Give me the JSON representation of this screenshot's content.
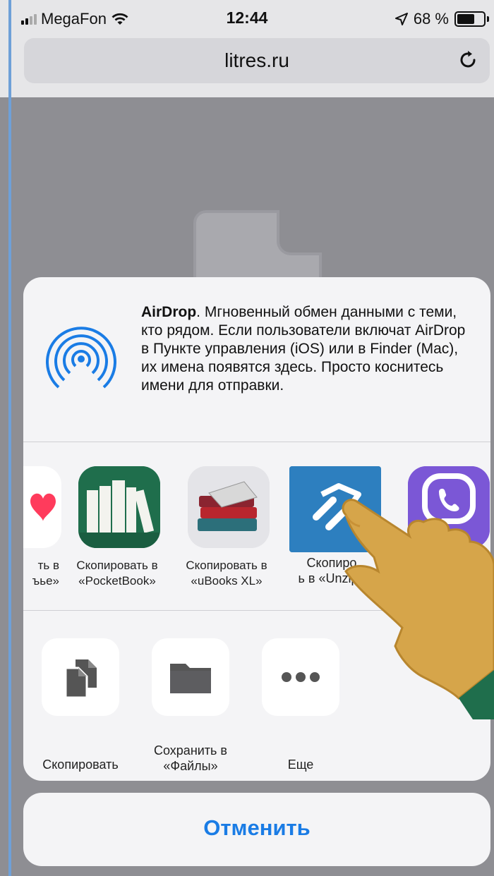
{
  "status_bar": {
    "carrier": "MegaFon",
    "time": "12:44",
    "battery_percent": "68 %",
    "battery_level": 0.68
  },
  "address_bar": {
    "url": "litres.ru"
  },
  "share_sheet": {
    "airdrop": {
      "title": "AirDrop",
      "description": ". Мгновенный обмен данными с теми, кто рядом. Если пользователи включат AirDrop в Пункте управления (iOS) или в Finder (Mac), их имена появятся здесь. Просто коснитесь имени для отправки."
    },
    "apps": [
      {
        "label_line1": "ть в",
        "label_line2": "ъье»",
        "icon": "heart-app-icon"
      },
      {
        "label_line1": "Скопировать в",
        "label_line2": "«PocketBook»",
        "icon": "pocketbook-icon"
      },
      {
        "label_line1": "Скопировать в",
        "label_line2": "«uBooks XL»",
        "icon": "ubooks-icon"
      },
      {
        "label_line1": "Скопиро",
        "label_line2": "ь в «Unzip»",
        "icon": "unzip-icon"
      },
      {
        "label_line1": "",
        "label_line2": "",
        "icon": "viber-icon"
      }
    ],
    "actions": [
      {
        "label": "Скопировать",
        "icon": "copy-icon"
      },
      {
        "label": "Сохранить в «Файлы»",
        "icon": "folder-icon"
      },
      {
        "label": "Еще",
        "icon": "more-icon"
      }
    ],
    "cancel_label": "Отменить"
  },
  "colors": {
    "accent": "#1a7ce5",
    "dim_background": "#8e8e93",
    "sheet_background": "#f4f4f6"
  }
}
